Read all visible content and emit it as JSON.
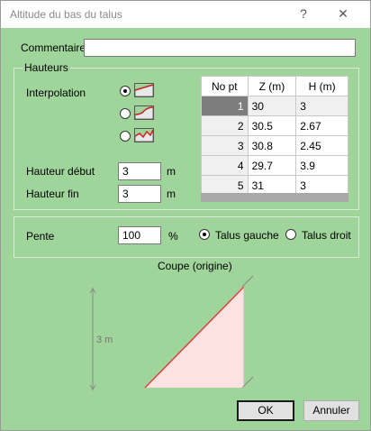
{
  "window": {
    "title": "Altitude du bas du talus",
    "help_glyph": "?",
    "close_glyph": "✕"
  },
  "commentaire": {
    "label": "Commentaire",
    "value": ""
  },
  "hauteurs": {
    "caption": "Hauteurs",
    "interpolation_label": "Interpolation",
    "interpolation_options": [
      {
        "icon": "linear-profile-icon",
        "selected": true
      },
      {
        "icon": "curve-profile-icon",
        "selected": false
      },
      {
        "icon": "jagged-profile-icon",
        "selected": false
      }
    ],
    "hauteur_debut": {
      "label": "Hauteur début",
      "value": "3",
      "unit": "m"
    },
    "hauteur_fin": {
      "label": "Hauteur fin",
      "value": "3",
      "unit": "m"
    },
    "table": {
      "headers": [
        "No pt",
        "Z (m)",
        "H (m)"
      ],
      "rows": [
        {
          "no": "1",
          "z": "30",
          "h": "3"
        },
        {
          "no": "2",
          "z": "30.5",
          "h": "2.67"
        },
        {
          "no": "3",
          "z": "30.8",
          "h": "2.45"
        },
        {
          "no": "4",
          "z": "29.7",
          "h": "3.9"
        },
        {
          "no": "5",
          "z": "31",
          "h": "3"
        }
      ]
    }
  },
  "pente": {
    "label": "Pente",
    "value": "100",
    "unit": "%",
    "talus_gauche": "Talus gauche",
    "talus_droit": "Talus droit",
    "selected": "gauche"
  },
  "coupe": {
    "title": "Coupe (origine)",
    "height_label": "3 m"
  },
  "buttons": {
    "ok": "OK",
    "annuler": "Annuler"
  },
  "colors": {
    "background": "#9fd59a",
    "slope_line": "#e04040",
    "slope_fill": "#fde2e2"
  }
}
